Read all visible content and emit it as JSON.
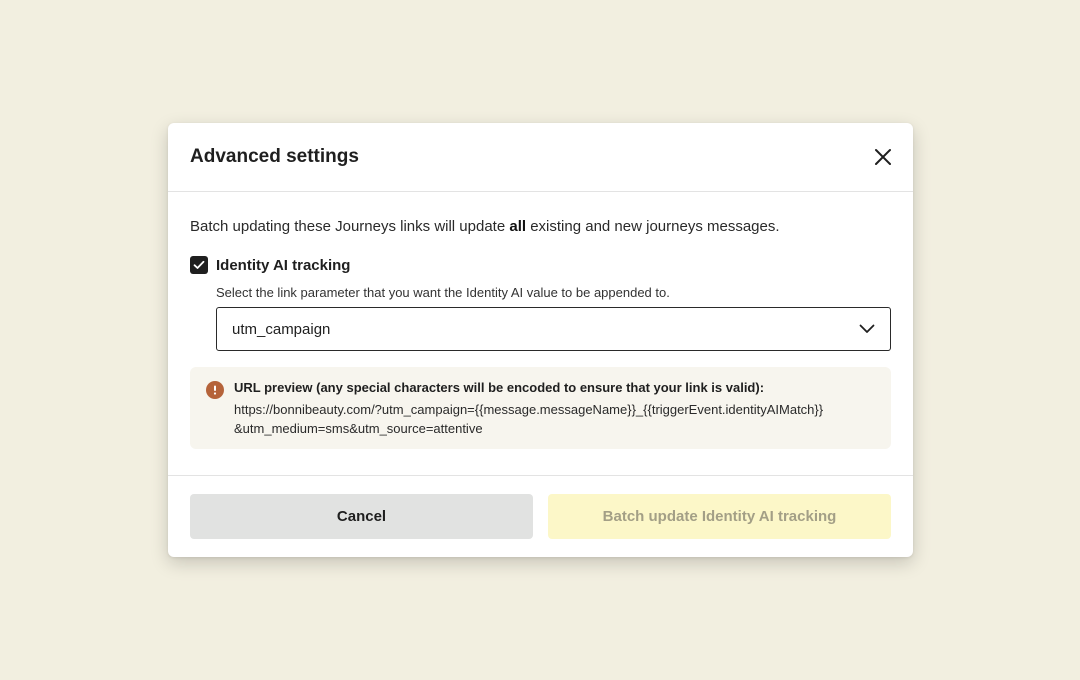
{
  "modal": {
    "title": "Advanced settings",
    "intro_before": "Batch updating these Journeys links will update ",
    "intro_bold": "all",
    "intro_after": " existing and new journeys messages.",
    "checkbox": {
      "label": "Identity AI tracking",
      "checked": true
    },
    "helper_text": "Select the link parameter that you want the Identity AI value to be appended to.",
    "select": {
      "value": "utm_campaign"
    },
    "preview": {
      "title": "URL  preview (any special characters will be encoded to ensure that your link is valid):",
      "url_line1": "https://bonnibeauty.com/?utm_campaign={{message.messageName}}_{{triggerEvent.identityAIMatch}}",
      "url_line2": "&utm_medium=sms&utm_source=attentive"
    },
    "buttons": {
      "cancel": "Cancel",
      "primary": "Batch update Identity AI tracking"
    }
  },
  "icons": {
    "close": "close-icon",
    "check": "check-icon",
    "chevron": "chevron-down-icon",
    "info": "info-icon"
  },
  "colors": {
    "background": "#f2efe0",
    "info_icon": "#b5633a",
    "primary_button_disabled": "#fcf7c8",
    "cancel_button": "#e1e2e1"
  }
}
